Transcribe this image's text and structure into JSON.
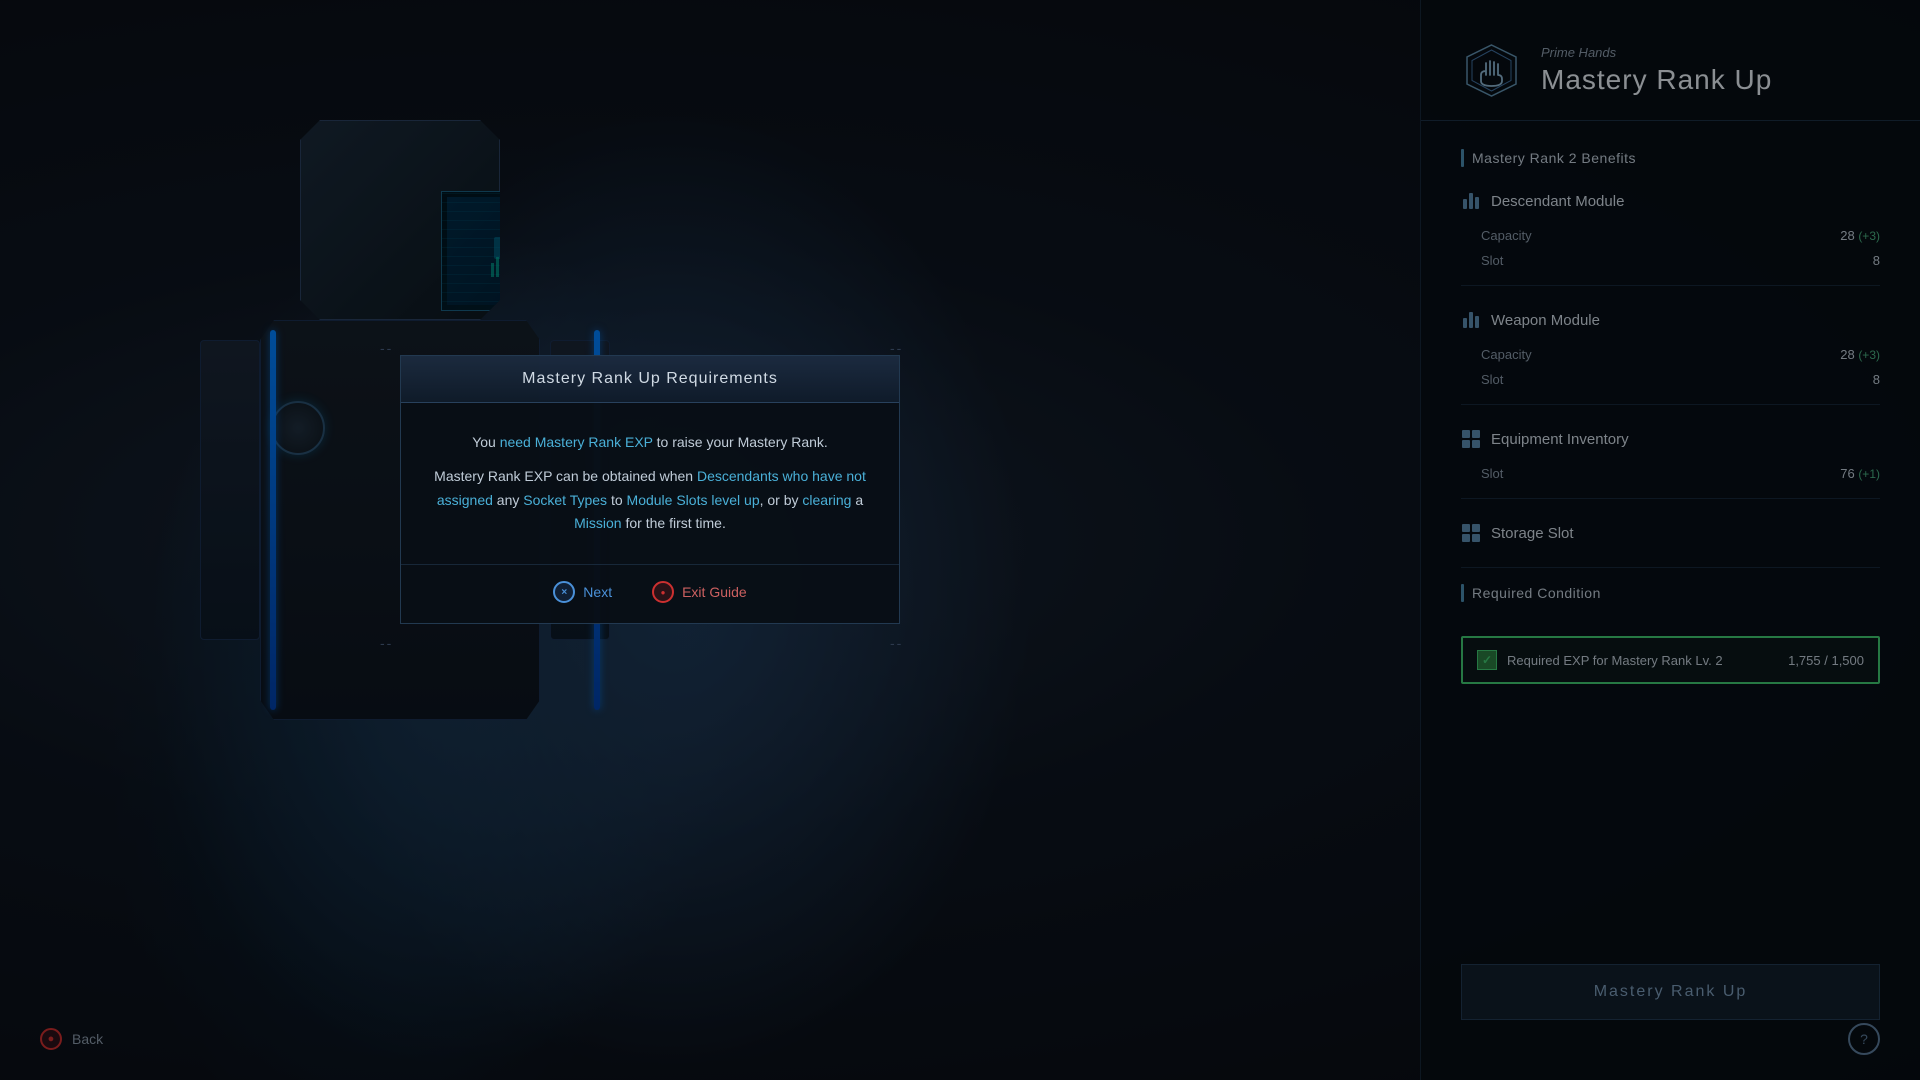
{
  "background": {
    "color": "#0a0e14"
  },
  "header": {
    "subtitle": "Prime Hands",
    "title": "Mastery Rank Up"
  },
  "sections": {
    "benefits_label": "Mastery Rank 2 Benefits",
    "descendant_module": {
      "label": "Descendant Module",
      "capacity_label": "Capacity",
      "capacity_value": "28",
      "capacity_bonus": "(+3)",
      "slot_label": "Slot",
      "slot_value": "8"
    },
    "weapon_module": {
      "label": "Weapon Module",
      "capacity_label": "Capacity",
      "capacity_value": "28",
      "capacity_bonus": "(+3)",
      "slot_label": "Slot",
      "slot_value": "8"
    },
    "equipment_inventory": {
      "label": "Equipment Inventory",
      "slot_label": "Slot",
      "slot_value": "76",
      "slot_bonus": "(+1)"
    },
    "storage_slot": {
      "label": "Storage Slot"
    },
    "required_condition": {
      "label": "Required Condition",
      "row_label": "Required EXP for Mastery Rank Lv. 2",
      "row_value": "1,755 / 1,500"
    }
  },
  "rank_up_button": {
    "label": "Mastery Rank Up"
  },
  "back_button": {
    "label": "Back"
  },
  "help_button": {
    "label": "?"
  },
  "modal": {
    "title": "Mastery Rank Up Requirements",
    "body_part1": "You ",
    "body_highlight1": "need Mastery Rank EXP",
    "body_part2": " to raise your Mastery Rank.",
    "body_part3": "Mastery Rank EXP can be obtained when ",
    "body_highlight2": "Descendants who have not assigned",
    "body_part4": " any ",
    "body_highlight3": "Socket Types",
    "body_part5": " to ",
    "body_highlight4": "Module Slots level up",
    "body_part6": ", or by ",
    "body_highlight5": "clearing",
    "body_part7": " a ",
    "body_highlight6": "Mission",
    "body_part8": " for the first time.",
    "next_label": "Next",
    "exit_label": "Exit Guide",
    "next_icon": "×",
    "exit_icon": "●"
  },
  "corners": {
    "dash": "--"
  }
}
